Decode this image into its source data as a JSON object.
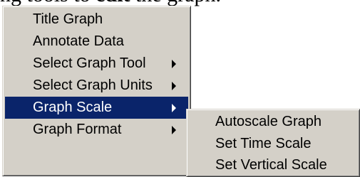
{
  "background_text": {
    "prefix": "ng tools to ",
    "emphasis": "edit",
    "suffix": " the graph."
  },
  "context_menu": {
    "items": [
      {
        "label": "Title Graph",
        "has_submenu": false,
        "active": false
      },
      {
        "label": "Annotate Data",
        "has_submenu": false,
        "active": false
      },
      {
        "label": "Select Graph Tool",
        "has_submenu": true,
        "active": false
      },
      {
        "label": "Select Graph Units",
        "has_submenu": true,
        "active": false
      },
      {
        "label": "Graph Scale",
        "has_submenu": true,
        "active": true
      },
      {
        "label": "Graph Format",
        "has_submenu": true,
        "active": false
      }
    ]
  },
  "submenu": {
    "parent": "Graph Scale",
    "items": [
      {
        "label": "Autoscale Graph"
      },
      {
        "label": "Set Time Scale"
      },
      {
        "label": "Set Vertical Scale"
      }
    ]
  },
  "colors": {
    "menu_background": "#d4d0c8",
    "highlight": "#0a246a",
    "highlight_text": "#ffffff"
  }
}
